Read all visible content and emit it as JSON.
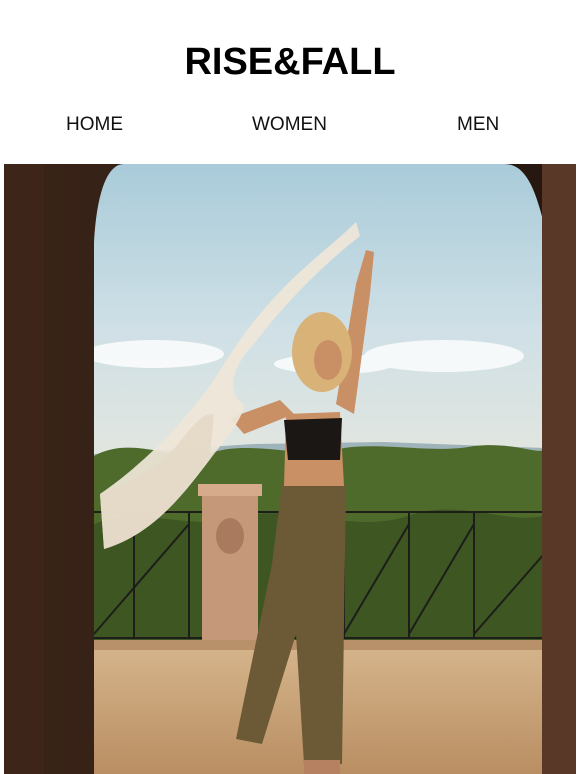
{
  "brand": {
    "logo_text": "RISE&FALL"
  },
  "nav": {
    "items": [
      {
        "label": "HOME"
      },
      {
        "label": "WOMEN"
      },
      {
        "label": "MEN"
      }
    ]
  },
  "hero": {
    "image_name": "hero-image",
    "colors": {
      "sky_top": "#a9cbd9",
      "sky_bottom": "#d9e4e6",
      "wall_dark": "#2a1a12",
      "ground": "#c9a57c",
      "trousers": "#6b5a35",
      "scarf": "#efe6d8",
      "foliage": "#4c6a2a"
    }
  }
}
